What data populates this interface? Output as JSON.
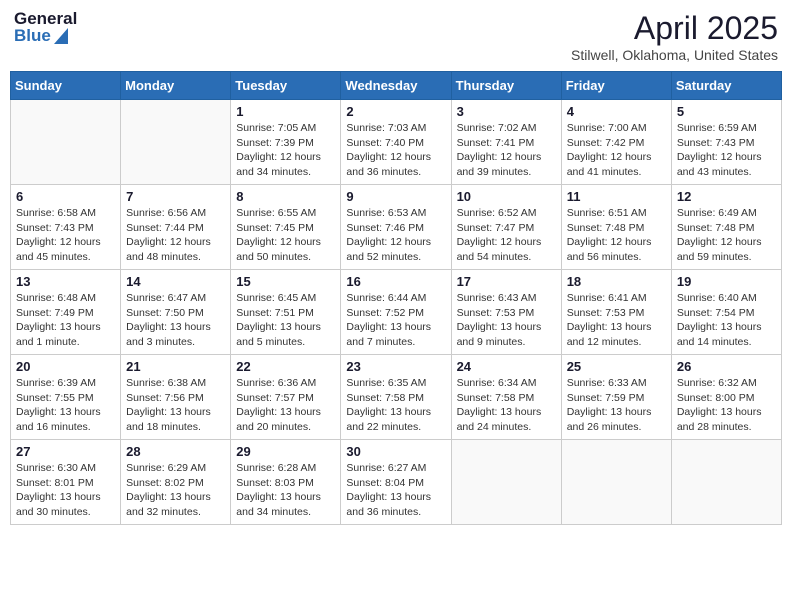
{
  "header": {
    "logo_general": "General",
    "logo_blue": "Blue",
    "title": "April 2025",
    "subtitle": "Stilwell, Oklahoma, United States"
  },
  "calendar": {
    "headers": [
      "Sunday",
      "Monday",
      "Tuesday",
      "Wednesday",
      "Thursday",
      "Friday",
      "Saturday"
    ],
    "weeks": [
      [
        {
          "day": "",
          "info": ""
        },
        {
          "day": "",
          "info": ""
        },
        {
          "day": "1",
          "info": "Sunrise: 7:05 AM\nSunset: 7:39 PM\nDaylight: 12 hours and 34 minutes."
        },
        {
          "day": "2",
          "info": "Sunrise: 7:03 AM\nSunset: 7:40 PM\nDaylight: 12 hours and 36 minutes."
        },
        {
          "day": "3",
          "info": "Sunrise: 7:02 AM\nSunset: 7:41 PM\nDaylight: 12 hours and 39 minutes."
        },
        {
          "day": "4",
          "info": "Sunrise: 7:00 AM\nSunset: 7:42 PM\nDaylight: 12 hours and 41 minutes."
        },
        {
          "day": "5",
          "info": "Sunrise: 6:59 AM\nSunset: 7:43 PM\nDaylight: 12 hours and 43 minutes."
        }
      ],
      [
        {
          "day": "6",
          "info": "Sunrise: 6:58 AM\nSunset: 7:43 PM\nDaylight: 12 hours and 45 minutes."
        },
        {
          "day": "7",
          "info": "Sunrise: 6:56 AM\nSunset: 7:44 PM\nDaylight: 12 hours and 48 minutes."
        },
        {
          "day": "8",
          "info": "Sunrise: 6:55 AM\nSunset: 7:45 PM\nDaylight: 12 hours and 50 minutes."
        },
        {
          "day": "9",
          "info": "Sunrise: 6:53 AM\nSunset: 7:46 PM\nDaylight: 12 hours and 52 minutes."
        },
        {
          "day": "10",
          "info": "Sunrise: 6:52 AM\nSunset: 7:47 PM\nDaylight: 12 hours and 54 minutes."
        },
        {
          "day": "11",
          "info": "Sunrise: 6:51 AM\nSunset: 7:48 PM\nDaylight: 12 hours and 56 minutes."
        },
        {
          "day": "12",
          "info": "Sunrise: 6:49 AM\nSunset: 7:48 PM\nDaylight: 12 hours and 59 minutes."
        }
      ],
      [
        {
          "day": "13",
          "info": "Sunrise: 6:48 AM\nSunset: 7:49 PM\nDaylight: 13 hours and 1 minute."
        },
        {
          "day": "14",
          "info": "Sunrise: 6:47 AM\nSunset: 7:50 PM\nDaylight: 13 hours and 3 minutes."
        },
        {
          "day": "15",
          "info": "Sunrise: 6:45 AM\nSunset: 7:51 PM\nDaylight: 13 hours and 5 minutes."
        },
        {
          "day": "16",
          "info": "Sunrise: 6:44 AM\nSunset: 7:52 PM\nDaylight: 13 hours and 7 minutes."
        },
        {
          "day": "17",
          "info": "Sunrise: 6:43 AM\nSunset: 7:53 PM\nDaylight: 13 hours and 9 minutes."
        },
        {
          "day": "18",
          "info": "Sunrise: 6:41 AM\nSunset: 7:53 PM\nDaylight: 13 hours and 12 minutes."
        },
        {
          "day": "19",
          "info": "Sunrise: 6:40 AM\nSunset: 7:54 PM\nDaylight: 13 hours and 14 minutes."
        }
      ],
      [
        {
          "day": "20",
          "info": "Sunrise: 6:39 AM\nSunset: 7:55 PM\nDaylight: 13 hours and 16 minutes."
        },
        {
          "day": "21",
          "info": "Sunrise: 6:38 AM\nSunset: 7:56 PM\nDaylight: 13 hours and 18 minutes."
        },
        {
          "day": "22",
          "info": "Sunrise: 6:36 AM\nSunset: 7:57 PM\nDaylight: 13 hours and 20 minutes."
        },
        {
          "day": "23",
          "info": "Sunrise: 6:35 AM\nSunset: 7:58 PM\nDaylight: 13 hours and 22 minutes."
        },
        {
          "day": "24",
          "info": "Sunrise: 6:34 AM\nSunset: 7:58 PM\nDaylight: 13 hours and 24 minutes."
        },
        {
          "day": "25",
          "info": "Sunrise: 6:33 AM\nSunset: 7:59 PM\nDaylight: 13 hours and 26 minutes."
        },
        {
          "day": "26",
          "info": "Sunrise: 6:32 AM\nSunset: 8:00 PM\nDaylight: 13 hours and 28 minutes."
        }
      ],
      [
        {
          "day": "27",
          "info": "Sunrise: 6:30 AM\nSunset: 8:01 PM\nDaylight: 13 hours and 30 minutes."
        },
        {
          "day": "28",
          "info": "Sunrise: 6:29 AM\nSunset: 8:02 PM\nDaylight: 13 hours and 32 minutes."
        },
        {
          "day": "29",
          "info": "Sunrise: 6:28 AM\nSunset: 8:03 PM\nDaylight: 13 hours and 34 minutes."
        },
        {
          "day": "30",
          "info": "Sunrise: 6:27 AM\nSunset: 8:04 PM\nDaylight: 13 hours and 36 minutes."
        },
        {
          "day": "",
          "info": ""
        },
        {
          "day": "",
          "info": ""
        },
        {
          "day": "",
          "info": ""
        }
      ]
    ]
  }
}
